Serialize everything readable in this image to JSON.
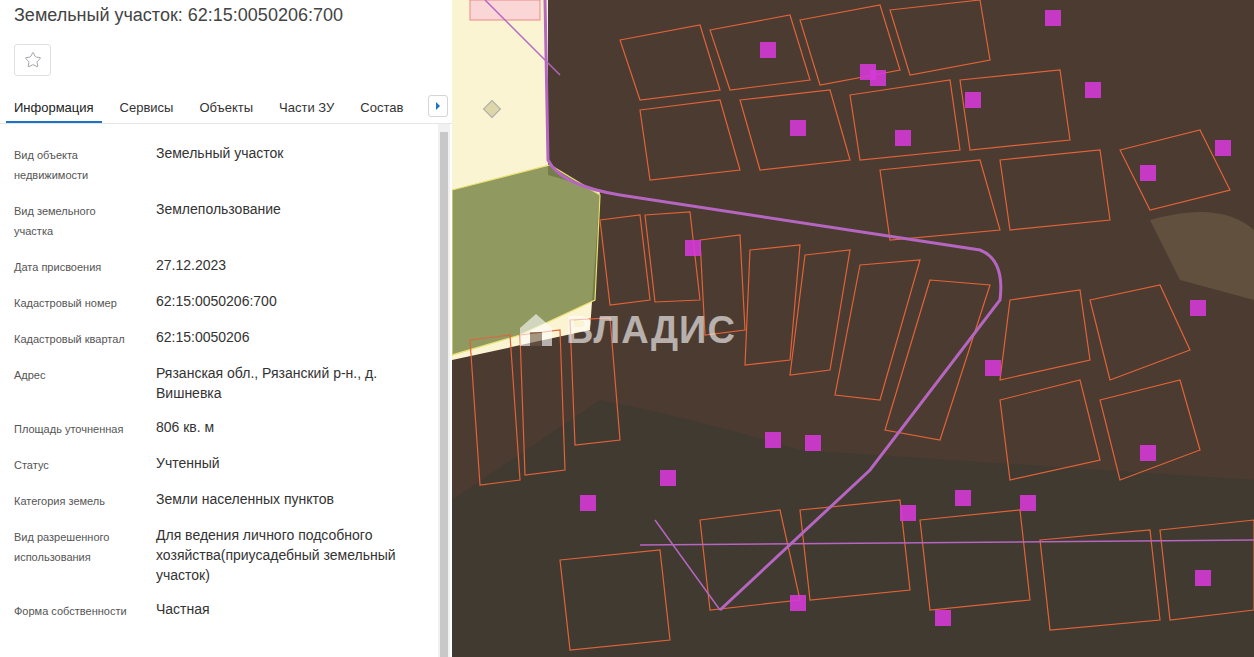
{
  "header": {
    "title": "Земельный участок: 62:15:0050206:700"
  },
  "tabs": [
    {
      "label": "Информация",
      "selected": true
    },
    {
      "label": "Сервисы",
      "selected": false
    },
    {
      "label": "Объекты",
      "selected": false
    },
    {
      "label": "Части ЗУ",
      "selected": false
    },
    {
      "label": "Состав",
      "selected": false
    }
  ],
  "fields": [
    {
      "label": "Вид объекта\nнедвижимости",
      "value": "Земельный участок"
    },
    {
      "label": "Вид земельного\nучастка",
      "value": "Землепользование"
    },
    {
      "label": "Дата присвоения",
      "value": "27.12.2023"
    },
    {
      "label": "Кадастровый номер",
      "value": "62:15:0050206:700"
    },
    {
      "label": "Кадастровый квартал",
      "value": "62:15:0050206"
    },
    {
      "label": "Адрес",
      "value": "Рязанская обл., Рязанский р-н., д.\nВишневка"
    },
    {
      "label": "Площадь уточненная",
      "value": "806 кв. м"
    },
    {
      "label": "Статус",
      "value": "Учтенный"
    },
    {
      "label": "Категория земель",
      "value": "Земли населенных пунктов"
    },
    {
      "label": "Вид разрешенного\nиспользования",
      "value": "Для ведения личного подсобного\nхозяйства(приусадебный земельный\nучасток)"
    },
    {
      "label": "Форма собственности",
      "value": "Частная"
    }
  ],
  "map": {
    "watermark": "ВЛАДИС"
  }
}
